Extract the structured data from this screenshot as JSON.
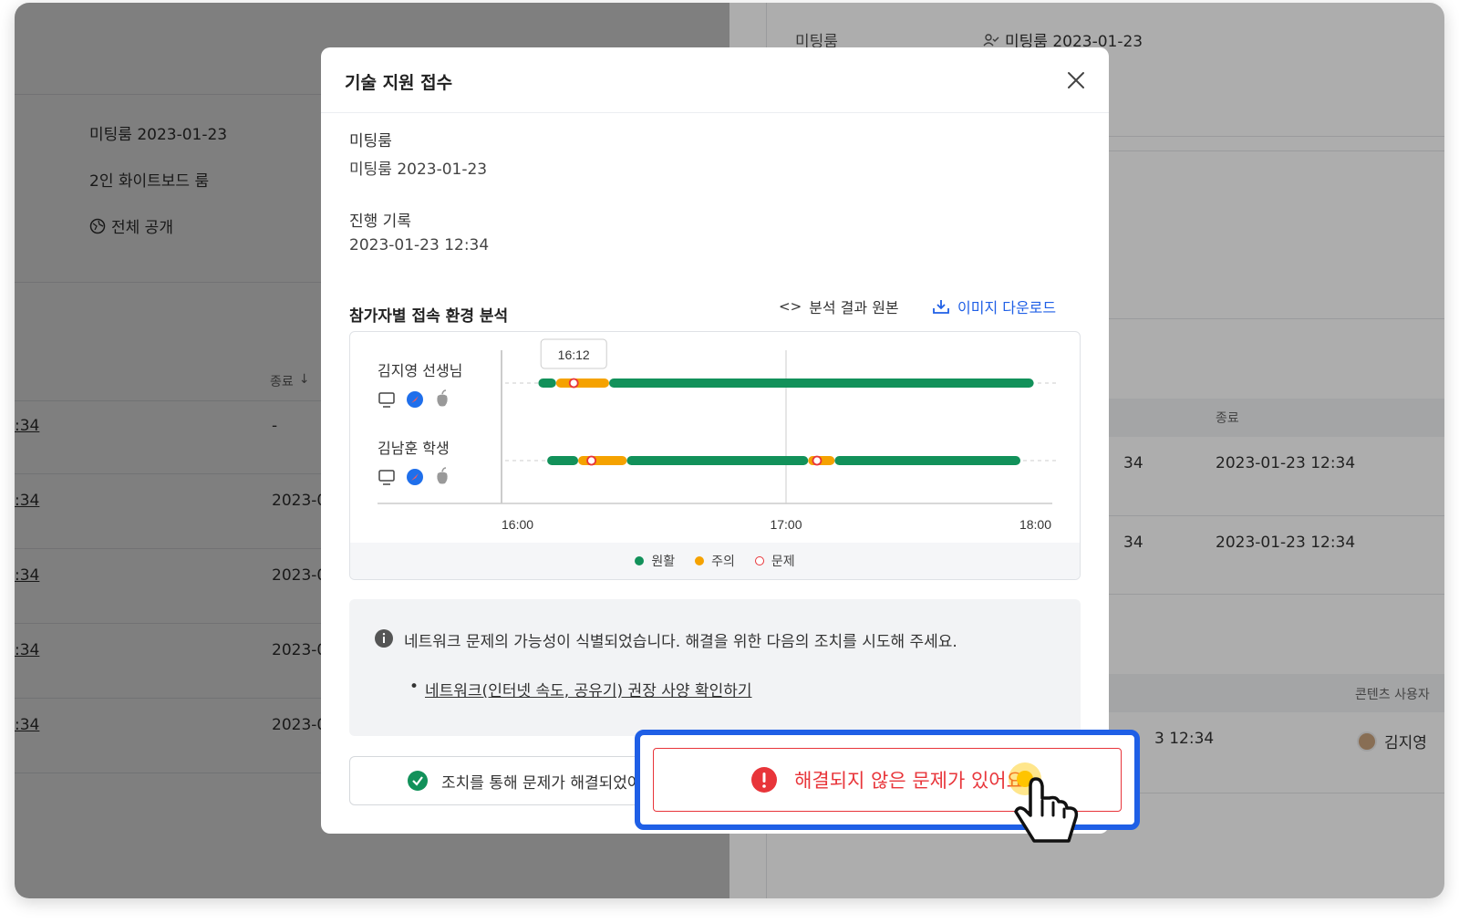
{
  "background": {
    "left": {
      "room_name": "미팅룸 2023-01-23",
      "room_type": "2인 화이트보드 룸",
      "visibility": "전체 공개",
      "column_end": "종료",
      "rows": [
        ":34",
        ":34",
        ":34",
        ":34",
        ":34"
      ],
      "end_values": [
        "-",
        "2023-0",
        "2023-0",
        "2023-0",
        "2023-0"
      ]
    },
    "right": {
      "label_room": "미팅룸",
      "room_value": "미팅룸 2023-01-23",
      "column_end": "종료",
      "column_content_user": "콘텐츠 사용자",
      "row_start_partial": [
        "34",
        "34"
      ],
      "row_end_values": [
        "2023-01-23 12:34",
        "2023-01-23 12:34"
      ],
      "row3_partial": "3 12:34",
      "user_name": "김지영"
    }
  },
  "modal": {
    "title": "기술 지원 접수",
    "room_label": "미팅룸",
    "room_value": "미팅룸 2023-01-23",
    "record_label": "진행 기록",
    "record_value": "2023-01-23 12:34",
    "analysis_title": "참가자별 접속 환경 분석",
    "raw_result_label": "분석 결과 원본",
    "download_label": "이미지 다운로드",
    "info_text": "네트워크 문제의 가능성이 식별되었습니다. 해결을 위한 다음의 조치를 시도해 주세요.",
    "info_link": "네트워크(인터넷 속도, 공유기) 권장 사양 확인하기",
    "resolved_label": "조치를 통해 문제가 해결되었어요",
    "unresolved_label": "해결되지 않은 문제가 있어요"
  },
  "colors": {
    "good": "#12915a",
    "warn": "#f5a200",
    "problem": "#e8353a",
    "accent": "#1f5fe6"
  },
  "chart_data": {
    "type": "timeline",
    "x_ticks": [
      "16:00",
      "17:00",
      "18:00"
    ],
    "x_range_minutes": [
      0,
      120
    ],
    "tooltip": "16:12",
    "legend": [
      "원활",
      "주의",
      "문제"
    ],
    "participants": [
      {
        "name": "김지영 선생님",
        "devices": [
          "desktop-icon",
          "safari-icon",
          "apple-icon"
        ],
        "segments": [
          {
            "status": "good",
            "start": 4,
            "end": 8
          },
          {
            "status": "warn",
            "start": 8,
            "end": 20
          },
          {
            "status": "good",
            "start": 20,
            "end": 116
          }
        ],
        "problems": [
          12
        ]
      },
      {
        "name": "김남훈 학생",
        "devices": [
          "desktop-icon",
          "safari-icon",
          "apple-icon"
        ],
        "segments": [
          {
            "status": "good",
            "start": 6,
            "end": 13
          },
          {
            "status": "warn",
            "start": 13,
            "end": 24
          },
          {
            "status": "good",
            "start": 24,
            "end": 65
          },
          {
            "status": "warn",
            "start": 65,
            "end": 71
          },
          {
            "status": "good",
            "start": 71,
            "end": 113
          }
        ],
        "problems": [
          16,
          67
        ]
      }
    ]
  }
}
